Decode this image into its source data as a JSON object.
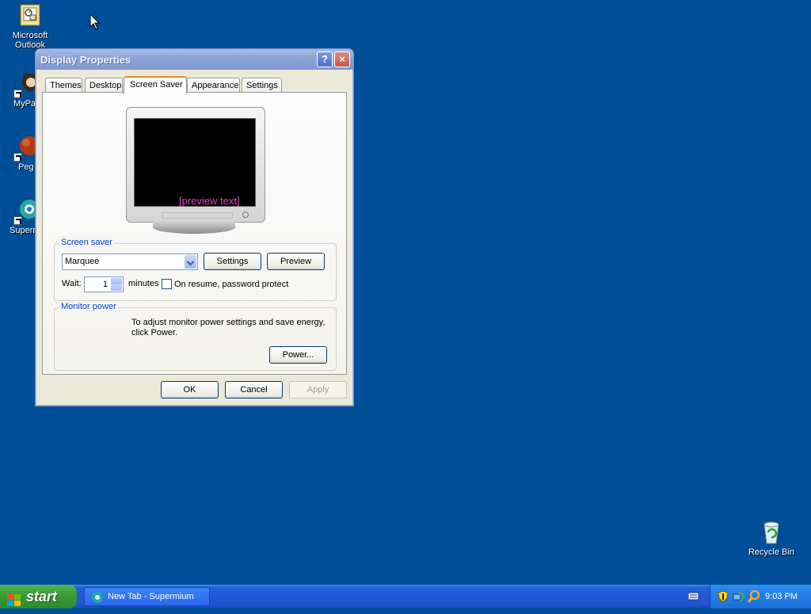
{
  "desktop": {
    "icons": [
      {
        "label": "Microsoft Outlook",
        "icon": "outlook-icon"
      },
      {
        "label": "MyPa",
        "icon": "mypal-icon"
      },
      {
        "label": "Peg",
        "icon": "pegasus-icon"
      },
      {
        "label": "Superr",
        "icon": "supermium-icon"
      },
      {
        "label": "Recycle Bin",
        "icon": "recycle-bin-icon"
      }
    ]
  },
  "window": {
    "title": "Display Properties",
    "help_button": "?",
    "close_button": "×",
    "tabs": [
      {
        "label": "Themes"
      },
      {
        "label": "Desktop"
      },
      {
        "label": "Screen Saver"
      },
      {
        "label": "Appearance"
      },
      {
        "label": "Settings"
      }
    ],
    "active_tab": "Screen Saver",
    "preview": {
      "marquee_text": "[preview text]",
      "marquee_color": "#e43fc8"
    },
    "screen_saver": {
      "group_label": "Screen saver",
      "selected": "Marquee",
      "settings_button": "Settings",
      "preview_button": "Preview",
      "wait_label": "Wait:",
      "wait_value": "1",
      "minutes_label": "minutes",
      "password_protect_label": "On resume, password protect",
      "password_protect_checked": false
    },
    "monitor_power": {
      "group_label": "Monitor power",
      "description_line1": "To adjust monitor power settings and save energy,",
      "description_line2": "click Power.",
      "power_button": "Power..."
    },
    "buttons": {
      "ok": "OK",
      "cancel": "Cancel",
      "apply": "Apply"
    }
  },
  "taskbar": {
    "start_label": "start",
    "tasks": [
      {
        "label": "New Tab - Supermium",
        "icon": "supermium-icon"
      }
    ],
    "clock": "9:03 PM",
    "tray_icons": [
      "security-shield-icon",
      "network-icon",
      "search-icon"
    ]
  }
}
